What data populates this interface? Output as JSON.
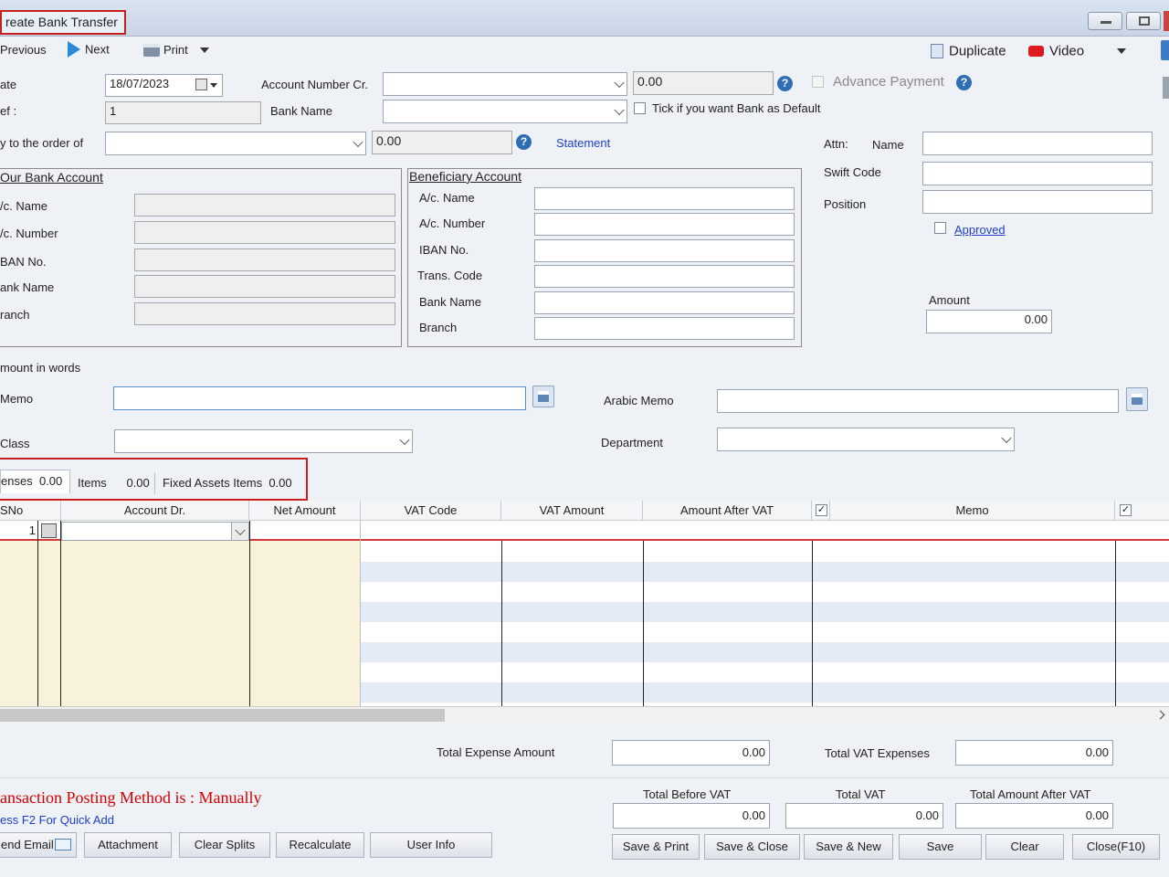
{
  "window": {
    "title": "reate Bank Transfer",
    "controls": [
      "minimize",
      "maximize"
    ]
  },
  "toolbar": {
    "previous": "Previous",
    "next": "Next",
    "print": "Print",
    "duplicate": "Duplicate",
    "video": "Video"
  },
  "header": {
    "date_label": "ate",
    "date_value": "18/07/2023",
    "ref_label": "ef :",
    "ref_value": "1",
    "pay_to_label": "y to the order of",
    "pay_to_amount": "0.00",
    "account_number_label": "Account Number Cr.",
    "account_amount": "0.00",
    "bank_name_label": "Bank Name",
    "advance_payment_label": "Advance Payment",
    "tick_default_label": "Tick if you want Bank as Default",
    "statement_link": "Statement",
    "attn_label": "Attn:",
    "name_label": "Name",
    "swift_label": "Swift Code",
    "position_label": "Position",
    "approved_label": "Approved",
    "amount_label": "Amount",
    "amount_value": "0.00"
  },
  "our_bank": {
    "title": "Our Bank Account",
    "fields": [
      "/c. Name",
      "/c. Number",
      "BAN No.",
      "ank Name",
      "ranch"
    ]
  },
  "beneficiary": {
    "title": "Beneficiary Account",
    "fields": [
      "A/c. Name",
      "A/c. Number",
      "IBAN No.",
      "Trans. Code",
      "Bank Name",
      "Branch"
    ]
  },
  "memo_section": {
    "amount_words_label": "mount in words",
    "memo_label": "Memo",
    "arabic_memo_label": "Arabic Memo",
    "class_label": "Class",
    "department_label": "Department"
  },
  "tabs": {
    "expenses_label": "enses",
    "expenses_value": "0.00",
    "items_label": "Items",
    "items_value": "0.00",
    "fixed_assets_label": "Fixed Assets Items",
    "fixed_assets_value": "0.00"
  },
  "grid": {
    "columns": [
      "SNo",
      "Account Dr.",
      "Net Amount",
      "VAT Code",
      "VAT Amount",
      "Amount After VAT",
      "Memo"
    ],
    "first_row_sno": "1"
  },
  "totals": {
    "total_expense_label": "Total Expense Amount",
    "total_expense_value": "0.00",
    "total_vat_exp_label": "Total VAT Expenses",
    "total_vat_exp_value": "0.00",
    "total_before_vat_label": "Total Before VAT",
    "total_before_vat_value": "0.00",
    "total_vat_label": "Total VAT",
    "total_vat_value": "0.00",
    "total_after_vat_label": "Total Amount After VAT",
    "total_after_vat_value": "0.00"
  },
  "footer": {
    "posting_method": "ansaction Posting Method is : Manually",
    "quick_add": "ess F2 For Quick Add",
    "buttons": {
      "send_email": "end Email",
      "attachment": "Attachment",
      "clear_splits": "Clear Splits",
      "recalculate": "Recalculate",
      "user_info": "User Info",
      "save_print": "Save & Print",
      "save_close": "Save & Close",
      "save_new": "Save & New",
      "save": "Save",
      "clear": "Clear",
      "close": "Close(F10)"
    }
  },
  "colors": {
    "accent_red": "#d40000",
    "link_blue": "#1f3fc8",
    "highlight_box": "#c81e1e",
    "grid_left_bg": "#f7f2d9"
  }
}
